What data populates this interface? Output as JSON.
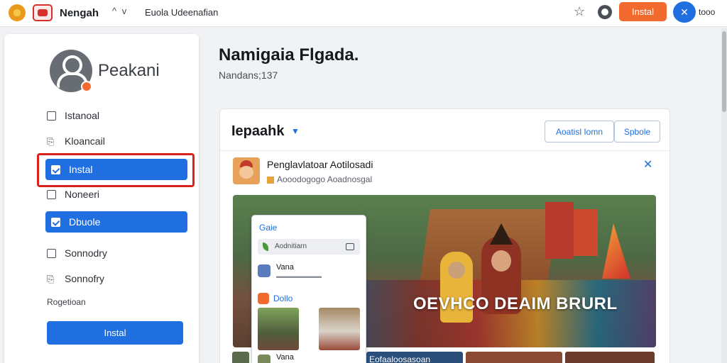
{
  "app": {
    "title": "Nengah",
    "nav_link": "Euola Udeenafian"
  },
  "topbar": {
    "install_label": "Instal",
    "user_name": "tooo",
    "avatar_glyph": "✕",
    "nav_arrows": "^ v"
  },
  "sidebar": {
    "profile_name": "Peakani",
    "items": [
      {
        "label": "Istanoal",
        "icon": "checkbox-icon",
        "active": false
      },
      {
        "label": "Kloancail",
        "icon": "document-icon",
        "active": false
      },
      {
        "label": "Instal",
        "icon": "checkbox-icon",
        "active": true
      },
      {
        "label": "Noneeri",
        "icon": "checkbox-icon",
        "active": false
      },
      {
        "label": "Dbuole",
        "icon": "checkbox-icon",
        "active": true
      },
      {
        "label": "Sonnodry",
        "icon": "checkbox-icon",
        "active": false
      },
      {
        "label": "Sonnofry",
        "icon": "document-icon",
        "active": false
      }
    ],
    "caption": "Rogetioan",
    "install_label": "Instal"
  },
  "main": {
    "title": "Namigaia Flgada.",
    "subtitle": "Nandans;137"
  },
  "card": {
    "heading": "Iepaahk",
    "button_primary": "Aoatisl Iomn",
    "button_secondary": "Spbole",
    "post": {
      "title": "Penglavlatoar Aotilosadi",
      "meta": "Aooodogogo Aoadnosgal"
    },
    "hero_caption": "OEVHCO DEAIM BRURL",
    "popup": {
      "header": "Gaie",
      "field": "Aodnitiarn",
      "user1_name": "Vana",
      "section": "Dollo",
      "user2_name": "Vana"
    },
    "strip_label": "Eofaaloosasoan"
  },
  "colors": {
    "accent": "#1f6fe0",
    "install": "#f26a2e",
    "highlight": "#d8221b"
  }
}
